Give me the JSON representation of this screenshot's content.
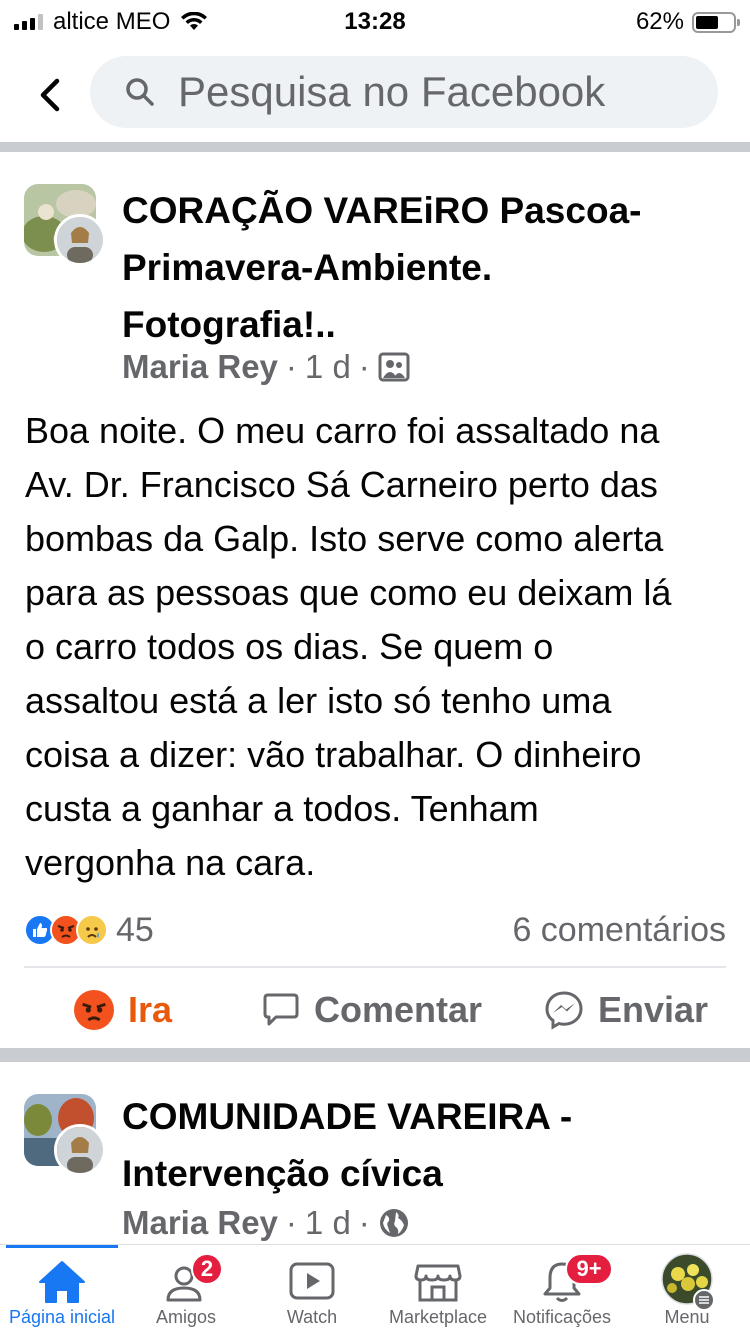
{
  "status_bar": {
    "carrier": "altice MEO",
    "time": "13:28",
    "battery": "62%",
    "battery_level": 0.62
  },
  "search": {
    "placeholder": "Pesquisa no Facebook"
  },
  "posts": [
    {
      "title_lines": [
        "CORAÇÃO VAREiRO Pascoa-",
        "Primavera-Ambiente.",
        "Fotografia!.."
      ],
      "author": "Maria Rey",
      "time": "1 d",
      "privacy_icon": "group-members-icon",
      "body_lines": [
        "Boa noite. O meu carro foi assaltado na",
        "Av. Dr. Francisco Sá Carneiro perto das",
        "bombas da Galp. Isto serve como alerta",
        "para as pessoas que como eu deixam lá",
        "o carro todos os dias. Se quem o",
        "assaltou está a ler isto só tenho uma",
        "coisa a dizer: vão trabalhar. O dinheiro",
        "custa a ganhar a todos. Tenham",
        "vergonha na cara."
      ],
      "reaction_count": "45",
      "comments": "6 comentários",
      "actions": {
        "react": "Ira",
        "comment": "Comentar",
        "share": "Enviar"
      }
    },
    {
      "title_lines": [
        "COMUNIDADE VAREIRA -",
        "Intervenção cívica"
      ],
      "author": "Maria Rey",
      "time": "1 d",
      "privacy_icon": "globe-icon"
    }
  ],
  "tabbar": {
    "home": "Página inicial",
    "friends": "Amigos",
    "friends_badge": "2",
    "watch": "Watch",
    "marketplace": "Marketplace",
    "notifications": "Notificações",
    "notifications_badge": "9+",
    "menu": "Menu"
  },
  "colors": {
    "brand": "#1877f2",
    "angry": "#e8590c",
    "badge": "#e41e3f",
    "secondary_text": "#65676b"
  }
}
